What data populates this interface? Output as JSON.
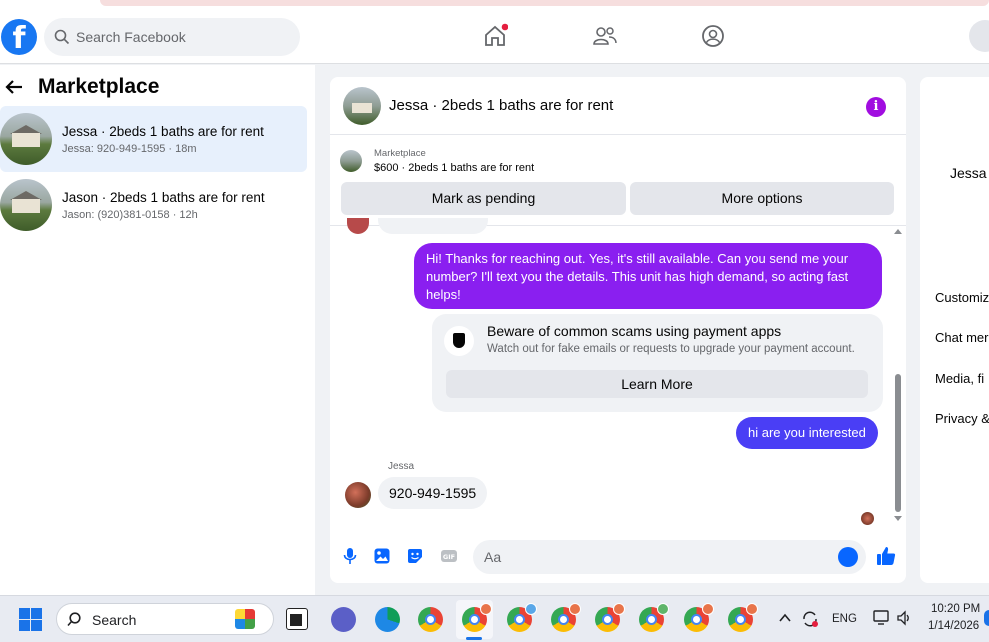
{
  "header": {
    "logo": "f",
    "search_placeholder": "Search Facebook"
  },
  "sidebar": {
    "title": "Marketplace",
    "conversations": [
      {
        "name": "Jessa · 2beds 1 baths are for rent",
        "sub": "Jessa: 920-949-1595 · 18m",
        "active": true
      },
      {
        "name": "Jason · 2beds 1 baths are for rent",
        "sub": "Jason: (920)381-0158 · 12h",
        "active": false
      }
    ]
  },
  "chat": {
    "title": "Jessa · 2beds 1 baths are for rent",
    "marketplace_label": "Marketplace",
    "listing": "$600 · 2beds 1 baths are for rent",
    "mark_pending": "Mark as pending",
    "more_options": "More options",
    "message_out_1": "Hi! Thanks for reaching out. Yes, it's still available. Can you send me your number? I'll text you the details. This unit has high demand, so acting fast helps!",
    "warning": {
      "title": "Beware of common scams using payment apps",
      "body": "Watch out for fake emails or requests to upgrade your payment account.",
      "button": "Learn More"
    },
    "message_out_2": "hi are you interested",
    "sender_label": "Jessa",
    "message_in": "920-949-1595",
    "composer_placeholder": "Aa"
  },
  "right_panel": {
    "name": "Jessa",
    "items": [
      "Customiz",
      "Chat mer",
      "Media, fi",
      "Privacy &"
    ]
  },
  "taskbar": {
    "search_placeholder": "Search",
    "language": "ENG",
    "time": "10:20 PM",
    "date": "1/14/2026"
  },
  "colors": {
    "facebook_blue": "#1877f2",
    "message_purple": "#8a1ff0",
    "message_blue": "#4a3ef5",
    "info_purple": "#a10de0"
  }
}
